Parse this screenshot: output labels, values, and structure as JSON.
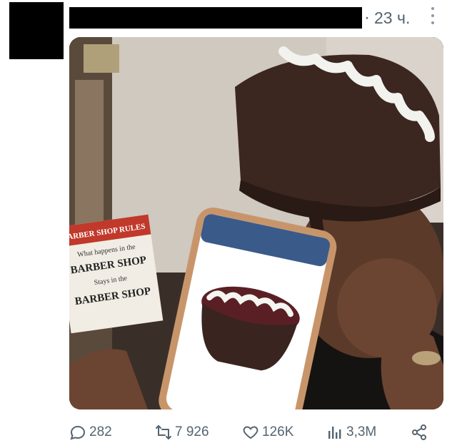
{
  "post": {
    "time": "23 ч.",
    "separator": "·"
  },
  "media": {
    "sign_title": "BARBER SHOP RULES",
    "sign_line1": "What happens in the",
    "sign_line2": "BARBER SHOP",
    "sign_line3": "Stays in the",
    "sign_line4": "BARBER SHOP"
  },
  "actions": {
    "replies": "282",
    "reposts": "7 926",
    "likes": "126K",
    "views": "3,3M"
  },
  "colors": {
    "icon_gray": "#536471",
    "text": "#0f1419"
  }
}
